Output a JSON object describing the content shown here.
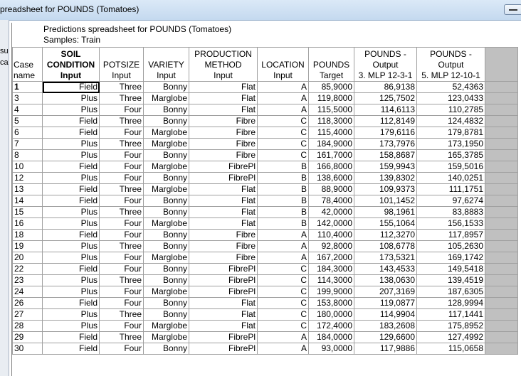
{
  "window": {
    "title": "preadsheet for POUNDS (Tomatoes)"
  },
  "left_panel": {
    "fragments": [
      "su",
      "ca"
    ]
  },
  "sheet": {
    "title": "Predictions spreadsheet for POUNDS (Tomatoes)",
    "samples": "Samples: Train",
    "case_header": [
      "Case",
      "name"
    ],
    "columns": [
      {
        "lines": [
          "SOIL",
          "CONDITION",
          "Input"
        ],
        "bold": true
      },
      {
        "lines": [
          "POTSIZE",
          "Input"
        ],
        "bold": false
      },
      {
        "lines": [
          "VARIETY",
          "Input"
        ],
        "bold": false
      },
      {
        "lines": [
          "PRODUCTION",
          "METHOD",
          "Input"
        ],
        "bold": false
      },
      {
        "lines": [
          "LOCATION",
          "Input"
        ],
        "bold": false
      },
      {
        "lines": [
          "POUNDS",
          "Target"
        ],
        "bold": false
      },
      {
        "lines": [
          "POUNDS -",
          "Output",
          "3. MLP 12-3-1"
        ],
        "bold": false
      },
      {
        "lines": [
          "POUNDS -",
          "Output",
          "5. MLP 12-10-1"
        ],
        "bold": false
      }
    ],
    "rows": [
      [
        "1",
        "Field",
        "Three",
        "Bonny",
        "Flat",
        "A",
        "85,9000",
        "86,9138",
        "52,4363"
      ],
      [
        "3",
        "Plus",
        "Three",
        "Marglobe",
        "Flat",
        "A",
        "119,8000",
        "125,7502",
        "123,0433"
      ],
      [
        "4",
        "Plus",
        "Four",
        "Bonny",
        "Flat",
        "A",
        "115,5000",
        "114,6113",
        "110,2785"
      ],
      [
        "5",
        "Field",
        "Three",
        "Bonny",
        "Fibre",
        "C",
        "118,3000",
        "112,8149",
        "124,4832"
      ],
      [
        "6",
        "Field",
        "Four",
        "Marglobe",
        "Fibre",
        "C",
        "115,4000",
        "179,6116",
        "179,8781"
      ],
      [
        "7",
        "Plus",
        "Three",
        "Marglobe",
        "Fibre",
        "C",
        "184,9000",
        "173,7976",
        "173,1950"
      ],
      [
        "8",
        "Plus",
        "Four",
        "Bonny",
        "Fibre",
        "C",
        "161,7000",
        "158,8687",
        "165,3785"
      ],
      [
        "10",
        "Field",
        "Four",
        "Marglobe",
        "FibrePl",
        "B",
        "166,8000",
        "159,9943",
        "159,5016"
      ],
      [
        "12",
        "Plus",
        "Four",
        "Bonny",
        "FibrePl",
        "B",
        "138,6000",
        "139,8302",
        "140,0251"
      ],
      [
        "13",
        "Field",
        "Three",
        "Marglobe",
        "Flat",
        "B",
        "88,9000",
        "109,9373",
        "111,1751"
      ],
      [
        "14",
        "Field",
        "Four",
        "Bonny",
        "Flat",
        "B",
        "78,4000",
        "101,1452",
        "97,6274"
      ],
      [
        "15",
        "Plus",
        "Three",
        "Bonny",
        "Flat",
        "B",
        "42,0000",
        "98,1961",
        "83,8883"
      ],
      [
        "16",
        "Plus",
        "Four",
        "Marglobe",
        "Flat",
        "B",
        "142,0000",
        "155,1064",
        "156,1533"
      ],
      [
        "18",
        "Field",
        "Four",
        "Bonny",
        "Fibre",
        "A",
        "110,4000",
        "112,3270",
        "117,8957"
      ],
      [
        "19",
        "Plus",
        "Three",
        "Bonny",
        "Fibre",
        "A",
        "92,8000",
        "108,6778",
        "105,2630"
      ],
      [
        "20",
        "Plus",
        "Four",
        "Marglobe",
        "Fibre",
        "A",
        "167,2000",
        "173,5321",
        "169,1742"
      ],
      [
        "22",
        "Field",
        "Four",
        "Bonny",
        "FibrePl",
        "C",
        "184,3000",
        "143,4533",
        "149,5418"
      ],
      [
        "23",
        "Plus",
        "Three",
        "Bonny",
        "FibrePl",
        "C",
        "114,3000",
        "138,0630",
        "139,4519"
      ],
      [
        "24",
        "Plus",
        "Four",
        "Marglobe",
        "FibrePl",
        "C",
        "199,9000",
        "207,3169",
        "187,6305"
      ],
      [
        "26",
        "Field",
        "Four",
        "Bonny",
        "Flat",
        "C",
        "153,8000",
        "119,0877",
        "128,9994"
      ],
      [
        "27",
        "Plus",
        "Three",
        "Bonny",
        "Flat",
        "C",
        "180,0000",
        "114,9904",
        "117,1441"
      ],
      [
        "28",
        "Plus",
        "Four",
        "Marglobe",
        "Flat",
        "C",
        "172,4000",
        "183,2608",
        "175,8952"
      ],
      [
        "29",
        "Field",
        "Three",
        "Marglobe",
        "FibrePl",
        "A",
        "184,0000",
        "129,6600",
        "127,4992"
      ],
      [
        "30",
        "Field",
        "Four",
        "Bonny",
        "FibrePl",
        "A",
        "93,0000",
        "117,9886",
        "115,0658"
      ]
    ],
    "selected_row": "1"
  }
}
